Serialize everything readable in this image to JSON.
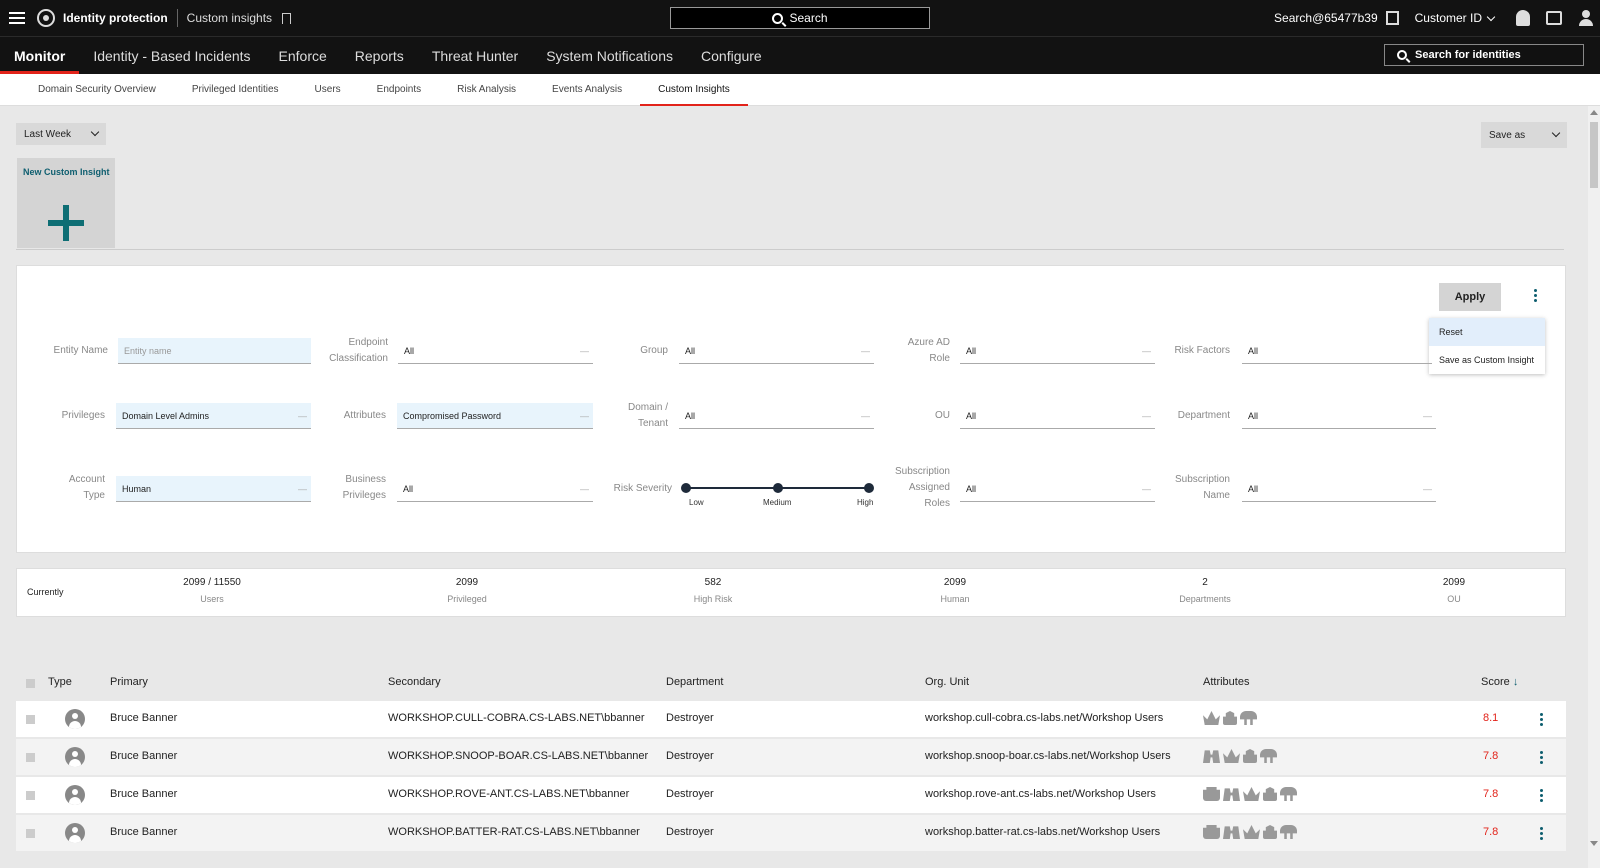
{
  "topbar": {
    "app_title": "Identity protection",
    "breadcrumb": "Custom insights",
    "search_label": "Search",
    "account": "Search@65477b39",
    "customer": "Customer ID"
  },
  "nav": {
    "items": [
      "Monitor",
      "Identity - Based Incidents",
      "Enforce",
      "Reports",
      "Threat Hunter",
      "System Notifications",
      "Configure"
    ],
    "id_search_placeholder": "Search for identities"
  },
  "subtabs": [
    "Domain Security Overview",
    "Privileged Identities",
    "Users",
    "Endpoints",
    "Risk Analysis",
    "Events Analysis",
    "Custom Insights"
  ],
  "toolbar": {
    "period": "Last Week",
    "save_as": "Save as",
    "new_card": "New Custom Insight"
  },
  "filters": {
    "apply": "Apply",
    "menu": [
      "Reset",
      "Save as Custom Insight"
    ],
    "entity_name_label": "Entity Name",
    "entity_name_placeholder": "Entity name",
    "endpoint_label_1": "Endpoint",
    "endpoint_label_2": "Classification",
    "endpoint_value": "All",
    "group_label": "Group",
    "group_value": "All",
    "azure_label_1": "Azure AD",
    "azure_label_2": "Role",
    "azure_value": "All",
    "risk_factors_label": "Risk Factors",
    "risk_factors_value": "All",
    "privileges_label": "Privileges",
    "privileges_value": "Domain Level Admins",
    "attributes_label": "Attributes",
    "attributes_value": "Compromised Password",
    "domain_label_1": "Domain /",
    "domain_label_2": "Tenant",
    "domain_value": "All",
    "ou_label": "OU",
    "ou_value": "All",
    "department_label": "Department",
    "department_value": "All",
    "account_label_1": "Account",
    "account_label_2": "Type",
    "account_value": "Human",
    "business_label_1": "Business",
    "business_label_2": "Privileges",
    "business_value": "All",
    "risk_severity_label": "Risk Severity",
    "severity_levels": [
      "Low",
      "Medium",
      "High"
    ],
    "sub_roles_label_1": "Subscription",
    "sub_roles_label_2": "Assigned",
    "sub_roles_label_3": "Roles",
    "sub_roles_value": "All",
    "sub_name_label_1": "Subscription",
    "sub_name_label_2": "Name",
    "sub_name_value": "All"
  },
  "summary": {
    "currently": "Currently",
    "stats": [
      {
        "value": "2099 / 11550",
        "label": "Users"
      },
      {
        "value": "2099",
        "label": "Privileged"
      },
      {
        "value": "582",
        "label": "High Risk"
      },
      {
        "value": "2099",
        "label": "Human"
      },
      {
        "value": "2",
        "label": "Departments"
      },
      {
        "value": "2099",
        "label": "OU"
      }
    ]
  },
  "table": {
    "headers": [
      "Type",
      "Primary",
      "Secondary",
      "Department",
      "Org. Unit",
      "Attributes",
      "Score"
    ],
    "rows": [
      {
        "primary": "Bruce Banner",
        "secondary": "WORKSHOP.CULL-COBRA.CS-LABS.NET\\bbanner",
        "department": "Destroyer",
        "org_unit": "workshop.cull-cobra.cs-labs.net/Workshop Users",
        "attributes": [
          "crown-icon",
          "lock-icon",
          "mask-icon"
        ],
        "score": "8.1"
      },
      {
        "primary": "Bruce Banner",
        "secondary": "WORKSHOP.SNOOP-BOAR.CS-LABS.NET\\bbanner",
        "department": "Destroyer",
        "org_unit": "workshop.snoop-boar.cs-labs.net/Workshop Users",
        "attributes": [
          "binoculars-icon",
          "crown-icon",
          "lock-icon",
          "mask-icon"
        ],
        "score": "7.8"
      },
      {
        "primary": "Bruce Banner",
        "secondary": "WORKSHOP.ROVE-ANT.CS-LABS.NET\\bbanner",
        "department": "Destroyer",
        "org_unit": "workshop.rove-ant.cs-labs.net/Workshop Users",
        "attributes": [
          "gear-icon",
          "binoculars-icon",
          "crown-icon",
          "lock-icon",
          "mask-icon"
        ],
        "score": "7.8"
      },
      {
        "primary": "Bruce Banner",
        "secondary": "WORKSHOP.BATTER-RAT.CS-LABS.NET\\bbanner",
        "department": "Destroyer",
        "org_unit": "workshop.batter-rat.cs-labs.net/Workshop Users",
        "attributes": [
          "gear-icon",
          "binoculars-icon",
          "crown-icon",
          "lock-icon",
          "mask-icon"
        ],
        "score": "7.8"
      }
    ]
  },
  "colors": {
    "accent": "#e2231a",
    "teal": "#0e6e74",
    "dark": "#121212"
  }
}
